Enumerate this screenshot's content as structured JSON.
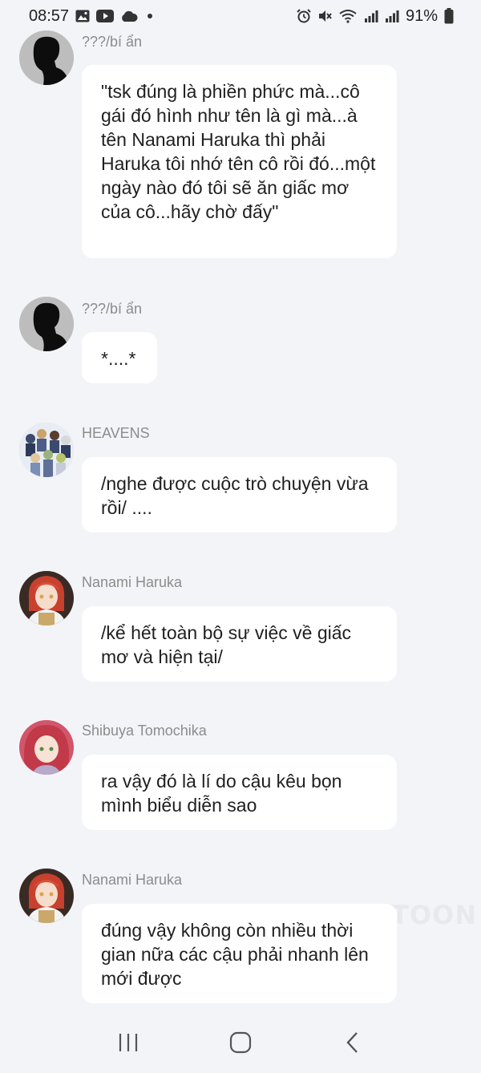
{
  "status_bar": {
    "time": "08:57",
    "battery_percent": "91%",
    "left_icons": [
      "gallery-icon",
      "youtube-icon",
      "cloud-icon",
      "dot-icon"
    ],
    "right_icons": [
      "alarm-icon",
      "mute-icon",
      "wifi-icon",
      "signal-icon",
      "signal-icon",
      "battery-icon"
    ]
  },
  "messages": [
    {
      "sender": "???/bí ẩn",
      "avatar": "silhouette",
      "text": "\"tsk đúng là phiền phức mà...cô gái đó hình như tên là gì mà...à tên Nanami Haruka thì phải Haruka tôi nhớ tên cô rồi đó...một ngày nào đó tôi sẽ ăn giấc mơ của cô...hãy chờ đấy\""
    },
    {
      "sender": "???/bí ẩn",
      "avatar": "silhouette",
      "text": "*....*"
    },
    {
      "sender": "HEAVENS",
      "avatar": "group",
      "text": "/nghe được cuộc trò chuyện vừa rồi/ ...."
    },
    {
      "sender": "Nanami Haruka",
      "avatar": "haruka",
      "text": "/kể hết toàn bộ sự việc về giấc mơ và hiện tại/"
    },
    {
      "sender": "Shibuya Tomochika",
      "avatar": "tomochika",
      "text": "ra vậy đó là lí do cậu kêu bọn mình biểu diễn sao"
    },
    {
      "sender": "Nanami Haruka",
      "avatar": "haruka",
      "text": "đúng vậy không còn nhiều thời gian nữa các cậu phải nhanh lên mới được"
    }
  ],
  "watermark": "TOON",
  "nav_bar": {
    "buttons": [
      "recent-apps",
      "home",
      "back"
    ]
  }
}
